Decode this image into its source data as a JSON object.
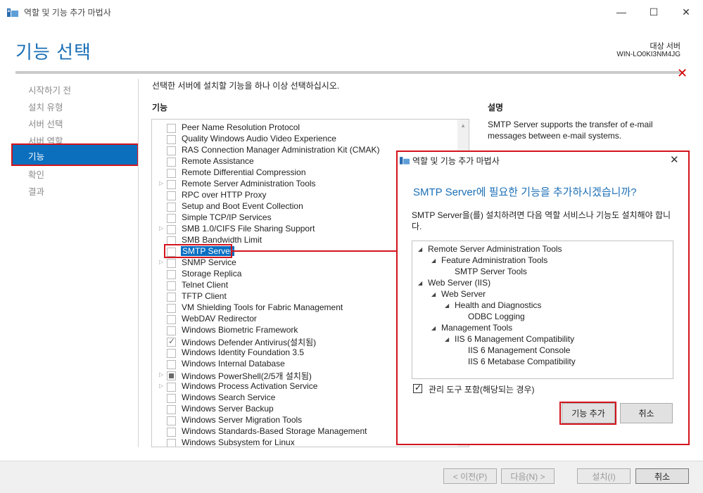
{
  "window": {
    "title": "역할 및 기능 추가 마법사",
    "minimize": "—",
    "maximize": "☐",
    "close": "✕"
  },
  "header": {
    "page_title": "기능 선택",
    "target_label": "대상 서버",
    "target_server": "WIN-LO0KI3NM4JG",
    "close_mark": "✕"
  },
  "nav": {
    "items": [
      "시작하기 전",
      "설치 유형",
      "서버 선택",
      "서버 역할",
      "기능",
      "확인",
      "결과"
    ],
    "active_index": 4
  },
  "main": {
    "instruction": "선택한 서버에 설치할 기능을 하나 이상 선택하십시오.",
    "features_heading": "기능",
    "description_heading": "설명",
    "description": "SMTP Server supports the transfer of e-mail messages between e-mail systems.",
    "features": [
      {
        "label": "Peer Name Resolution Protocol",
        "state": "unchecked",
        "expandable": false
      },
      {
        "label": "Quality Windows Audio Video Experience",
        "state": "unchecked",
        "expandable": false
      },
      {
        "label": "RAS Connection Manager Administration Kit (CMAK)",
        "state": "unchecked",
        "expandable": false
      },
      {
        "label": "Remote Assistance",
        "state": "unchecked",
        "expandable": false
      },
      {
        "label": "Remote Differential Compression",
        "state": "unchecked",
        "expandable": false
      },
      {
        "label": "Remote Server Administration Tools",
        "state": "unchecked",
        "expandable": true
      },
      {
        "label": "RPC over HTTP Proxy",
        "state": "unchecked",
        "expandable": false
      },
      {
        "label": "Setup and Boot Event Collection",
        "state": "unchecked",
        "expandable": false
      },
      {
        "label": "Simple TCP/IP Services",
        "state": "unchecked",
        "expandable": false
      },
      {
        "label": "SMB 1.0/CIFS File Sharing Support",
        "state": "unchecked",
        "expandable": true
      },
      {
        "label": "SMB Bandwidth Limit",
        "state": "unchecked",
        "expandable": false
      },
      {
        "label": "SMTP Server",
        "state": "unchecked",
        "expandable": false,
        "selected": true
      },
      {
        "label": "SNMP Service",
        "state": "unchecked",
        "expandable": true
      },
      {
        "label": "Storage Replica",
        "state": "unchecked",
        "expandable": false
      },
      {
        "label": "Telnet Client",
        "state": "unchecked",
        "expandable": false
      },
      {
        "label": "TFTP Client",
        "state": "unchecked",
        "expandable": false
      },
      {
        "label": "VM Shielding Tools for Fabric Management",
        "state": "unchecked",
        "expandable": false
      },
      {
        "label": "WebDAV Redirector",
        "state": "unchecked",
        "expandable": false
      },
      {
        "label": "Windows Biometric Framework",
        "state": "unchecked",
        "expandable": false
      },
      {
        "label": "Windows Defender Antivirus(설치됨)",
        "state": "checked",
        "expandable": false
      },
      {
        "label": "Windows Identity Foundation 3.5",
        "state": "unchecked",
        "expandable": false
      },
      {
        "label": "Windows Internal Database",
        "state": "unchecked",
        "expandable": false
      },
      {
        "label": "Windows PowerShell(2/5개 설치됨)",
        "state": "partial",
        "expandable": true
      },
      {
        "label": "Windows Process Activation Service",
        "state": "unchecked",
        "expandable": true
      },
      {
        "label": "Windows Search Service",
        "state": "unchecked",
        "expandable": false
      },
      {
        "label": "Windows Server Backup",
        "state": "unchecked",
        "expandable": false
      },
      {
        "label": "Windows Server Migration Tools",
        "state": "unchecked",
        "expandable": false
      },
      {
        "label": "Windows Standards-Based Storage Management",
        "state": "unchecked",
        "expandable": false
      },
      {
        "label": "Windows Subsystem for Linux",
        "state": "unchecked",
        "expandable": false
      }
    ]
  },
  "footer": {
    "prev": "< 이전(P)",
    "next": "다음(N) >",
    "install": "설치(I)",
    "cancel": "취소"
  },
  "dialog": {
    "title": "역할 및 기능 추가 마법사",
    "close": "✕",
    "heading": "SMTP Server에 필요한 기능을 추가하시겠습니까?",
    "body": "SMTP Server을(를) 설치하려면 다음 역할 서비스나 기능도 설치해야 합니다.",
    "tree": [
      {
        "label": "Remote Server Administration Tools",
        "level": 0,
        "expanded": true
      },
      {
        "label": "Feature Administration Tools",
        "level": 1,
        "expanded": true
      },
      {
        "label": "SMTP Server Tools",
        "level": 2,
        "expanded": null
      },
      {
        "label": "Web Server (IIS)",
        "level": 0,
        "expanded": true
      },
      {
        "label": "Web Server",
        "level": 1,
        "expanded": true
      },
      {
        "label": "Health and Diagnostics",
        "level": 2,
        "expanded": true
      },
      {
        "label": "ODBC Logging",
        "level": 3,
        "expanded": null
      },
      {
        "label": "Management Tools",
        "level": 1,
        "expanded": true
      },
      {
        "label": "IIS 6 Management Compatibility",
        "level": 2,
        "expanded": true
      },
      {
        "label": "IIS 6 Management Console",
        "level": 3,
        "expanded": null
      },
      {
        "label": "IIS 6 Metabase Compatibility",
        "level": 3,
        "expanded": null
      }
    ],
    "include_tools_label": "관리 도구 포함(해당되는 경우)",
    "include_tools_checked": true,
    "add_button": "기능 추가",
    "cancel_button": "취소"
  }
}
